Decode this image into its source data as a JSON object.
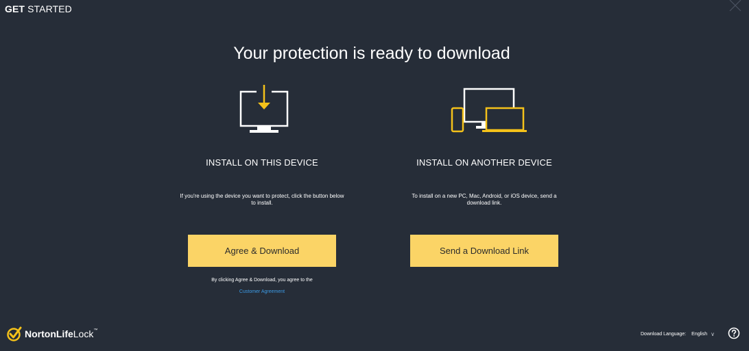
{
  "window": {
    "title_bold": "GET",
    "title_rest": " STARTED"
  },
  "main": {
    "heading": "Your protection is ready to download"
  },
  "left_option": {
    "icon": "monitor-download-icon",
    "title": "INSTALL ON THIS DEVICE",
    "description": "If you're using the device you want to protect, click the button below to install.",
    "button_label": "Agree & Download",
    "agreement_note": "By clicking Agree & Download, you agree to the",
    "agreement_link": "Customer Agreement"
  },
  "right_option": {
    "icon": "multiple-devices-icon",
    "title": "INSTALL ON ANOTHER DEVICE",
    "description": "To install on a new PC, Mac, Android, or iOS device, send a download link.",
    "button_label": "Send a Download Link"
  },
  "footer": {
    "logo_bold": "NortonLife",
    "logo_rest": "Lock",
    "logo_tm": "™",
    "language_label": "Download Language:",
    "language_value": "English",
    "help_icon": "help-icon"
  },
  "colors": {
    "background": "#262d38",
    "accent": "#fbd466",
    "link": "#3c9be6",
    "icon_yellow": "#f5c21a"
  }
}
